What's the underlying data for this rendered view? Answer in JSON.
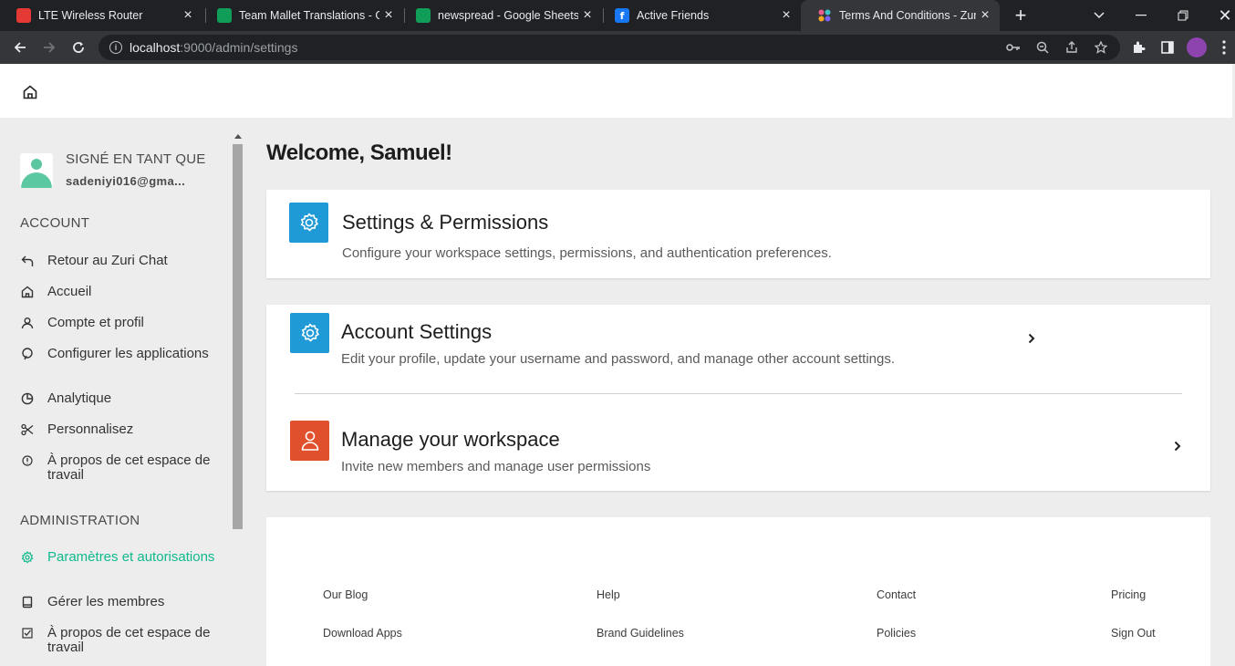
{
  "browser": {
    "tabs": [
      {
        "title": "LTE Wireless Router",
        "favicon": "lte-router-icon"
      },
      {
        "title": "Team Mallet Translations - Go",
        "favicon": "google-sheets-icon"
      },
      {
        "title": "newspread - Google Sheets",
        "favicon": "google-sheets-icon"
      },
      {
        "title": "Active Friends",
        "favicon": "facebook-icon"
      },
      {
        "title": "Terms And Conditions - Zuri",
        "favicon": "zuri-icon",
        "active": true
      }
    ],
    "fb_letter": "f",
    "url_host": "localhost",
    "url_path": ":9000/admin/settings"
  },
  "sidebar": {
    "signed_in_label": "SIGNÉ EN TANT QUE",
    "email": "sadeniyi016@gma...",
    "account_heading": "ACCOUNT",
    "account_items": [
      {
        "label": "Retour au Zuri Chat",
        "icon": "back-arrow-icon"
      },
      {
        "label": "Accueil",
        "icon": "home-icon"
      },
      {
        "label": "Compte et profil",
        "icon": "user-icon"
      },
      {
        "label": "Configurer les applications",
        "icon": "plug-icon"
      },
      {
        "label": "Analytique",
        "icon": "pie-chart-icon"
      },
      {
        "label": "Personnalisez",
        "icon": "scissors-icon"
      },
      {
        "label": "À propos de cet espace de travail",
        "icon": "info-icon"
      }
    ],
    "admin_heading": "ADMINISTRATION",
    "admin_items": [
      {
        "label": "Paramètres et autorisations",
        "icon": "gear-icon",
        "active": true
      },
      {
        "label": "Gérer les membres",
        "icon": "book-icon"
      },
      {
        "label": "À propos de cet espace de travail",
        "icon": "checkbox-icon"
      }
    ]
  },
  "main": {
    "welcome": "Welcome, Samuel!",
    "cards": [
      {
        "title": "Settings & Permissions",
        "description": "Configure your workspace settings, permissions, and authentication preferences.",
        "icon": "gear-icon",
        "color": "#1f9ad6"
      },
      {
        "title": "Account Settings",
        "description": "Edit your profile, update your username and password, and manage other account settings.",
        "icon": "gear-icon",
        "color": "#1f9ad6"
      },
      {
        "title": "Manage your workspace",
        "description": "Invite new members and manage user permissions",
        "icon": "user-icon",
        "color": "#e0502c"
      }
    ]
  },
  "footer": {
    "links": [
      "Our Blog",
      "Help",
      "Contact",
      "Pricing",
      "Download Apps",
      "Brand Guidelines",
      "Policies",
      "Sign Out"
    ]
  },
  "colors": {
    "accent_green": "#0fb98e",
    "icon_blue": "#1f9ad6",
    "icon_orange": "#e0502c",
    "chrome_dark": "#202124",
    "chrome_mid": "#35363a"
  }
}
